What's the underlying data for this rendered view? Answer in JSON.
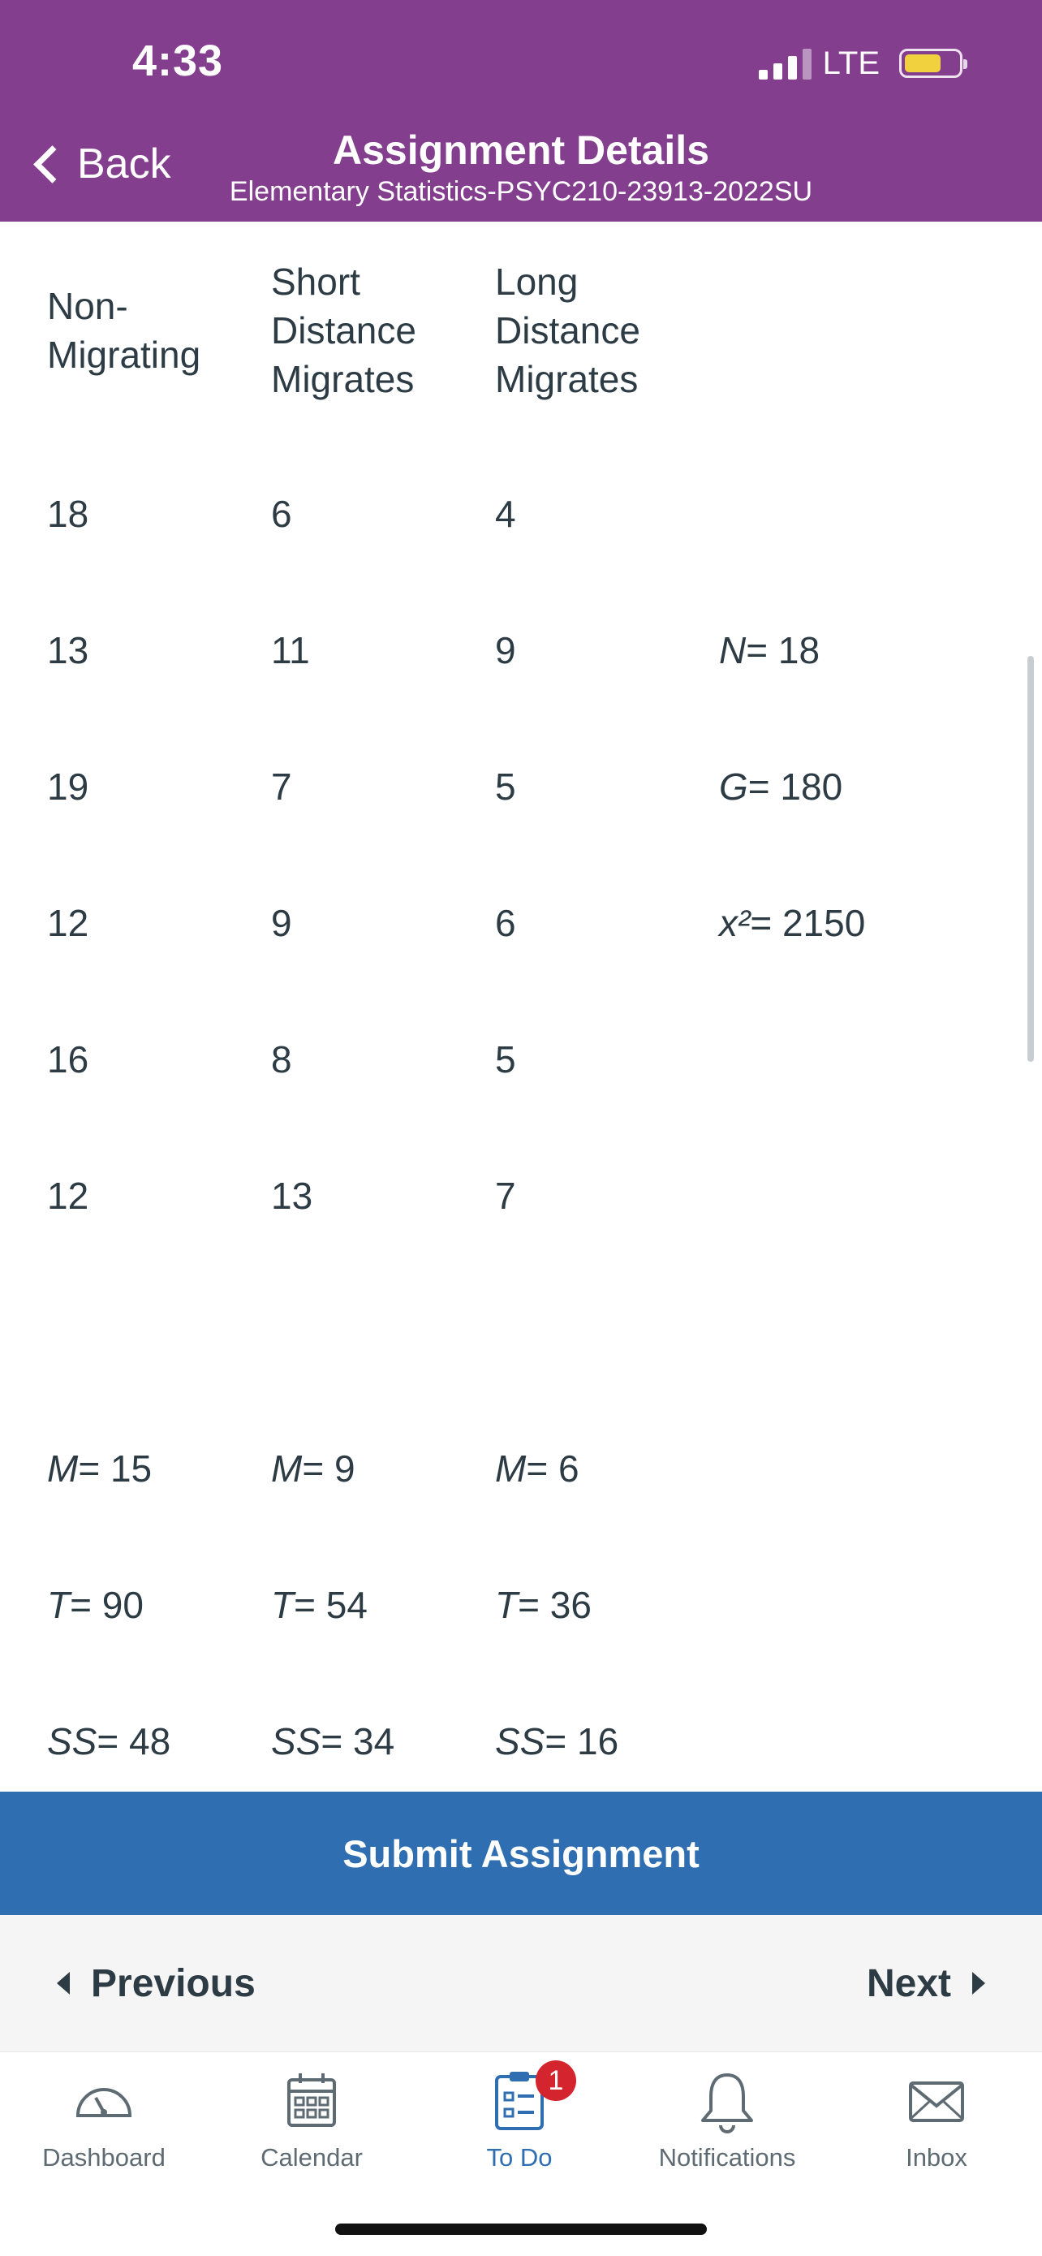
{
  "status_bar": {
    "time": "4:33",
    "network": "LTE"
  },
  "header": {
    "back_label": "Back",
    "title": "Assignment Details",
    "subtitle": "Elementary Statistics-PSYC210-23913-2022SU"
  },
  "table": {
    "headers": [
      "Non-\nMigrating",
      "Short\nDistance\nMigrates",
      "Long\nDistance\nMigrates"
    ],
    "rows": [
      [
        "18",
        "6",
        "4"
      ],
      [
        "13",
        "11",
        "9"
      ],
      [
        "19",
        "7",
        "5"
      ],
      [
        "12",
        "9",
        "6"
      ],
      [
        "16",
        "8",
        "5"
      ],
      [
        "12",
        "13",
        "7"
      ]
    ],
    "side_stats": [
      {
        "sym": "N",
        "val": "= 18"
      },
      {
        "sym": "G",
        "val": "= 180"
      },
      {
        "sym": "x²",
        "val": "= 2150"
      }
    ],
    "summary": [
      [
        {
          "sym": "M",
          "val": "= 15"
        },
        {
          "sym": "M",
          "val": "= 9"
        },
        {
          "sym": "M",
          "val": "= 6"
        }
      ],
      [
        {
          "sym": "T",
          "val": "= 90"
        },
        {
          "sym": "T",
          "val": "= 54"
        },
        {
          "sym": "T",
          "val": "= 36"
        }
      ],
      [
        {
          "sym": "SS",
          "val": "= 48"
        },
        {
          "sym": "SS",
          "val": "= 34"
        },
        {
          "sym": "SS",
          "val": "= 16"
        }
      ]
    ]
  },
  "actions": {
    "submit": "Submit Assignment",
    "previous": "Previous",
    "next": "Next"
  },
  "tabbar": {
    "tabs": [
      {
        "label": "Dashboard",
        "icon": "dashboard-icon"
      },
      {
        "label": "Calendar",
        "icon": "calendar-icon"
      },
      {
        "label": "To Do",
        "icon": "todo-icon",
        "badge": "1"
      },
      {
        "label": "Notifications",
        "icon": "bell-icon"
      },
      {
        "label": "Inbox",
        "icon": "mail-icon"
      }
    ]
  },
  "colors": {
    "header": "#843e8e",
    "submit": "#2f6fb1",
    "badge": "#d4252e",
    "battery": "#f2d13f"
  }
}
